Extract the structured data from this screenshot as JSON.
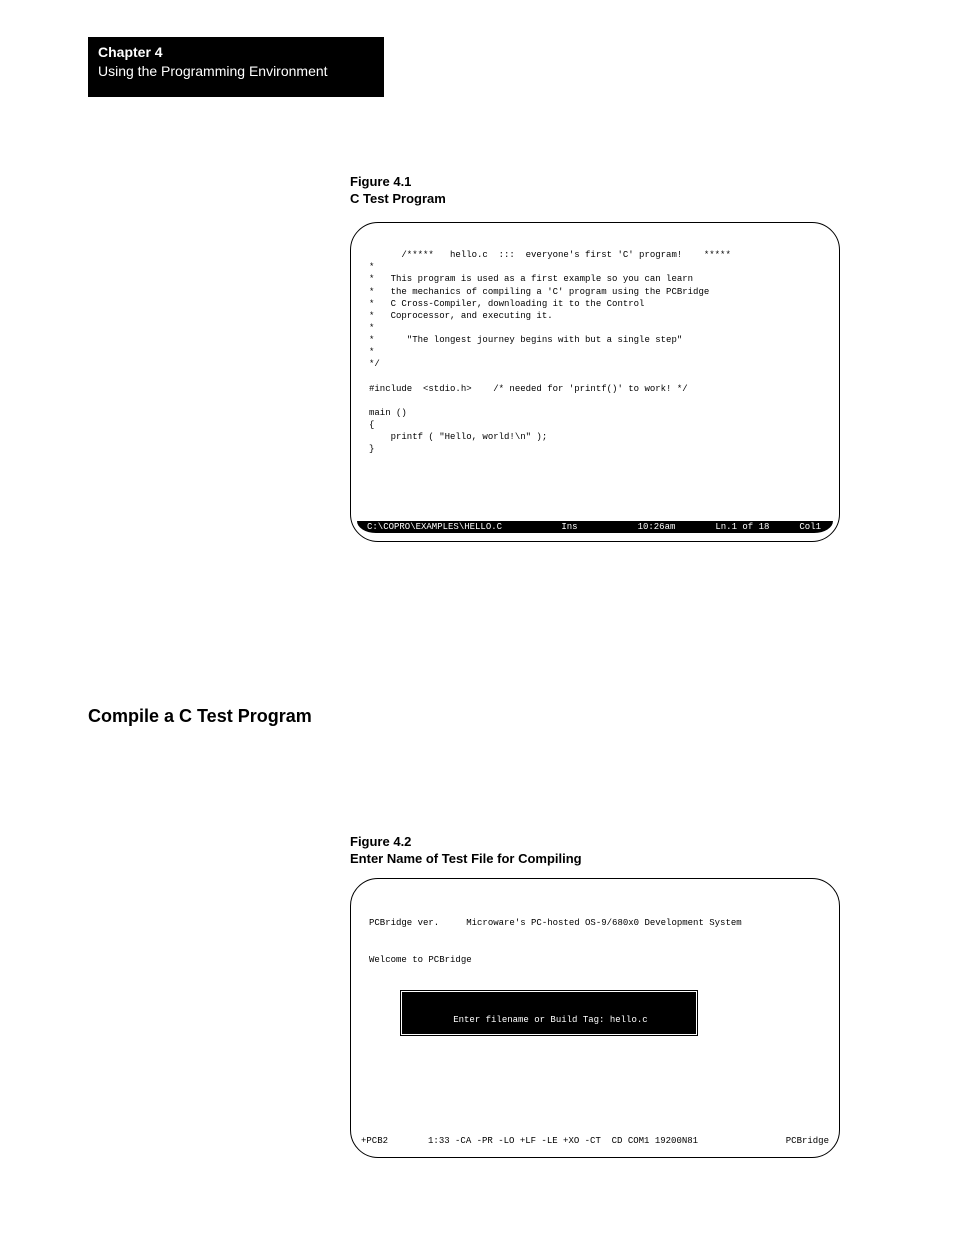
{
  "chapter": {
    "line1": "Chapter  4",
    "line2": "Using the Programming Environment"
  },
  "figure1": {
    "label_line1": "Figure 4.1",
    "label_line2": "C Test Program",
    "code": "/*****   hello.c  :::  everyone's first 'C' program!    *****\n*\n*   This program is used as a first example so you can learn\n*   the mechanics of compiling a 'C' program using the PCBridge\n*   C Cross-Compiler, downloading it to the Control\n*   Coprocessor, and executing it.\n*\n*      \"The longest journey begins with but a single step\"\n*\n*/\n\n#include  <stdio.h>    /* needed for 'printf()' to work! */\n\nmain ()\n{\n    printf ( \"Hello, world!\\n\" );\n}",
    "status": {
      "path": "C:\\COPRO\\EXAMPLES\\HELLO.C",
      "mode": "Ins",
      "time": "10:26am",
      "pos": "Ln.1 of 18",
      "col": "Col1"
    }
  },
  "section_heading": "Compile a C Test Program",
  "figure2": {
    "label_line1": "Figure 4.2",
    "label_line2": "Enter Name of Test File for Compiling",
    "banner_line1": "PCBridge ver.     Microware's PC-hosted OS-9/680x0 Development System",
    "banner_line2": "Welcome to PCBridge",
    "dialog_text": "Enter filename or Build Tag: hello.c",
    "footer": {
      "left": "+PCB2",
      "mid": "1:33 -CA -PR -LO +LF -LE +XO -CT  CD COM1 19200N81",
      "right": "PCBridge"
    }
  }
}
